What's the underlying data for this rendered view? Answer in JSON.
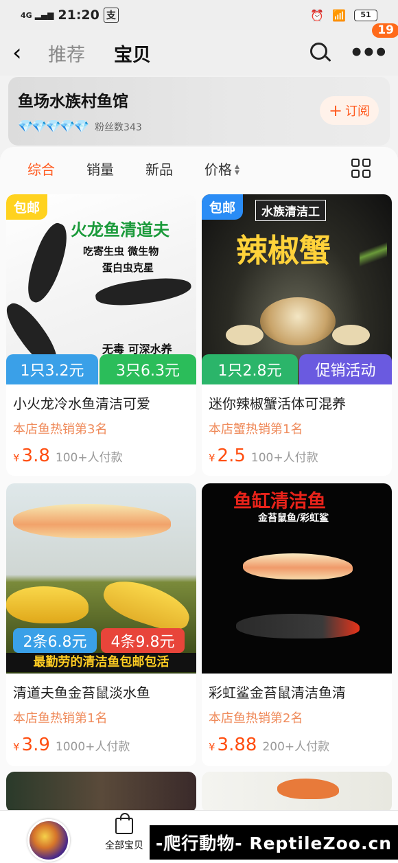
{
  "status_bar": {
    "network": "4G",
    "time": "21:20",
    "app_icon": "支",
    "battery": "51"
  },
  "nav": {
    "back_icon": "back-icon",
    "tabs": [
      "推荐",
      "宝贝"
    ],
    "badge": "19"
  },
  "shop": {
    "name": "鱼场水族村鱼馆",
    "diamonds": "💎💎💎💎💎",
    "fans": "粉丝数343",
    "subscribe_label": "订阅"
  },
  "sort_bar": {
    "items": [
      "综合",
      "销量",
      "新品",
      "价格"
    ]
  },
  "products": [
    {
      "title": "小火龙冷水鱼清洁可爱",
      "rank": "本店鱼热销第3名",
      "price_symbol": "¥",
      "price": "3.8",
      "sold": "100+人付款",
      "tag": "包邮",
      "image_texts": [
        "火龙鱼清道夫",
        "吃寄生虫 微生物",
        "蛋白虫克星",
        "无毒 可深水养"
      ],
      "price_tags": [
        "1只3.2元",
        "3只6.3元"
      ]
    },
    {
      "title": "迷你辣椒蟹活体可混养",
      "rank": "本店蟹热销第1名",
      "price_symbol": "¥",
      "price": "2.5",
      "sold": "100+人付款",
      "tag": "包邮",
      "image_texts": [
        "水族清洁工",
        "辣椒蟹"
      ],
      "price_tags": [
        "1只2.8元",
        "促销活动"
      ]
    },
    {
      "title": "清道夫鱼金苔鼠淡水鱼",
      "rank": "本店鱼热销第1名",
      "price_symbol": "¥",
      "price": "3.9",
      "sold": "1000+人付款",
      "image_texts": [
        "最勤劳的清洁鱼包邮包活"
      ],
      "price_tags": [
        "2条6.8元",
        "4条9.8元"
      ]
    },
    {
      "title": "彩虹鲨金苔鼠清洁鱼清",
      "rank": "本店鱼热销第2名",
      "price_symbol": "¥",
      "price": "3.88",
      "sold": "200+人付款",
      "image_texts": [
        "鱼缸清洁鱼",
        "金苔鼠鱼/彩虹鲨"
      ]
    }
  ],
  "bottom_bar": {
    "all_items_label": "全部宝贝",
    "watermark": "-爬行動物- ReptileZoo.cn"
  },
  "colors": {
    "accent": "#ff5a1f",
    "price": "#ff4e10",
    "badge": "#ff6a1a",
    "tag_yellow": "#ffd21f",
    "tag_blue": "#2a8cf5"
  }
}
